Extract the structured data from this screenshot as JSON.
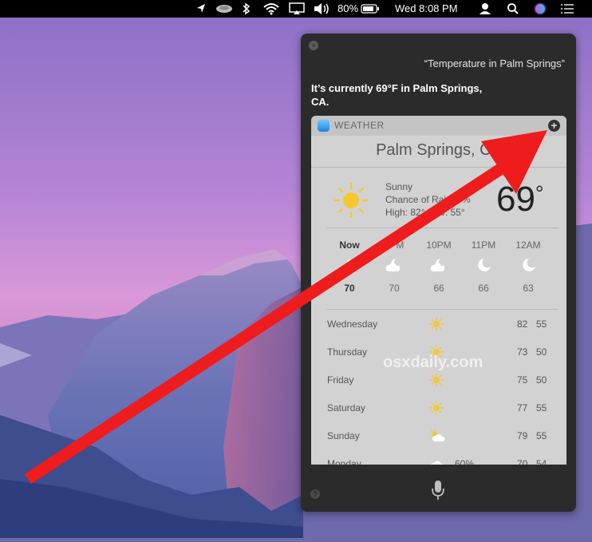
{
  "menubar": {
    "icons": [
      "location-arrow-icon",
      "disk-icon",
      "bluetooth-icon",
      "wifi-icon",
      "airplay-icon",
      "volume-icon",
      "battery-icon",
      "user-icon",
      "spotlight-search-icon",
      "siri-icon",
      "notification-center-icon"
    ],
    "battery_percent": "80%",
    "clock": "Wed 8:08 PM"
  },
  "siri": {
    "query": "“Temperature in Palm Springs”",
    "answer": "It’s currently 69°F in Palm Springs, CA."
  },
  "weather": {
    "app_name": "WEATHER",
    "city": "Palm Springs, CA",
    "condition": "Sunny",
    "chance_line": "Chance of Rain: 0%",
    "highlow_line": "High: 82° Low: 55°",
    "current_temp": "69",
    "degree": "°",
    "hourly": [
      {
        "time": "Now",
        "icon": "partly-cloudy-night-icon",
        "temp": "70"
      },
      {
        "time": "9PM",
        "icon": "partly-cloudy-night-icon",
        "temp": "70"
      },
      {
        "time": "10PM",
        "icon": "partly-cloudy-night-icon",
        "temp": "66"
      },
      {
        "time": "11PM",
        "icon": "clear-night-icon",
        "temp": "66"
      },
      {
        "time": "12AM",
        "icon": "clear-night-icon",
        "temp": "63"
      }
    ],
    "daily": [
      {
        "day": "Wednesday",
        "icon": "sun-icon",
        "pct": "",
        "hi": "82",
        "lo": "55"
      },
      {
        "day": "Thursday",
        "icon": "sun-icon",
        "pct": "",
        "hi": "73",
        "lo": "50"
      },
      {
        "day": "Friday",
        "icon": "sun-icon",
        "pct": "",
        "hi": "75",
        "lo": "50"
      },
      {
        "day": "Saturday",
        "icon": "sun-icon",
        "pct": "",
        "hi": "77",
        "lo": "55"
      },
      {
        "day": "Sunday",
        "icon": "partly-cloudy-icon",
        "pct": "",
        "hi": "79",
        "lo": "55"
      },
      {
        "day": "Monday",
        "icon": "cloudy-icon",
        "pct": "60%",
        "hi": "70",
        "lo": "54"
      }
    ]
  },
  "watermark": "osxdaily.com",
  "colors": {
    "arrow": "#ee1c1c",
    "siri_bg": "#2b2b2c",
    "card_bg": "#d2d2d2",
    "sun": "#f7c72e"
  }
}
